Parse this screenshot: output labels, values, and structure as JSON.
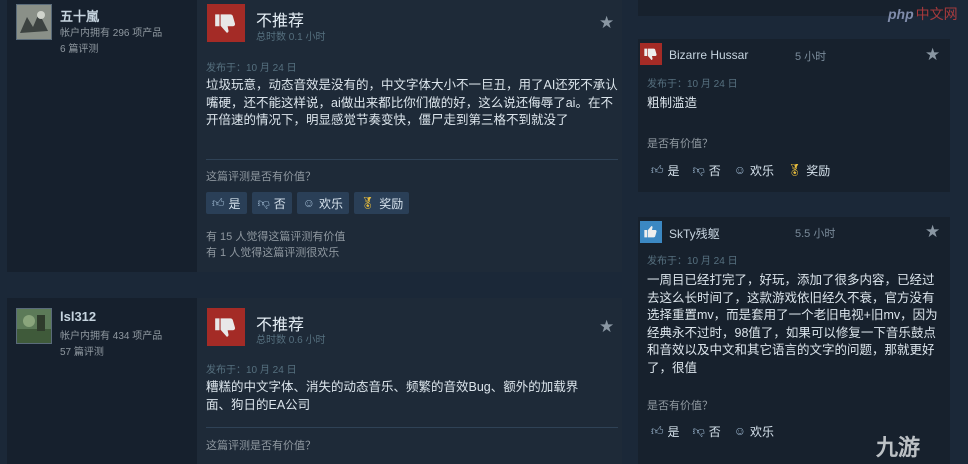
{
  "reviews_left": [
    {
      "username": "五十嵐",
      "products": "帐户内拥有 296 项产品",
      "review_count": "6 篇评测",
      "verdict": "不推荐",
      "hours": "总时数 0.1 小时",
      "posted": "发布于：10 月 24 日",
      "text": "垃圾玩意，动态音效是没有的，中文字体大小不一巨丑，用了AI还死不承认嘴硬，还不能这样说，ai做出来都比你们做的好，这么说还侮辱了ai。在不开倍速的情况下，明显感觉节奏变快，僵尸走到第三格不到就没了",
      "question": "这篇评测是否有价值？",
      "buttons": {
        "yes": "是",
        "no": "否",
        "funny": "欢乐",
        "award": "奖励"
      },
      "helpful": "有 15 人觉得这篇评测有价值",
      "funny_count": "有 1 人觉得这篇评测很欢乐"
    },
    {
      "username": "lsl312",
      "products": "帐户内拥有 434 项产品",
      "review_count": "57 篇评测",
      "verdict": "不推荐",
      "hours": "总时数 0.6 小时",
      "posted": "发布于：10 月 24 日",
      "text": "糟糕的中文字体、消失的动态音乐、频繁的音效Bug、额外的加载界面、狗日的EA公司",
      "question": "这篇评测是否有价值？"
    }
  ],
  "reviews_right": [
    {
      "username": "Bizarre Hussar",
      "hours": "5 小时",
      "posted": "发布于：10 月 24 日",
      "text": "粗制滥造",
      "question": "是否有价值？",
      "buttons": {
        "yes": "是",
        "no": "否",
        "funny": "欢乐",
        "award": "奖励"
      },
      "recommended": false
    },
    {
      "username": "SkTy残躯",
      "hours": "5.5 小时",
      "posted": "发布于：10 月 24 日",
      "text": "一周目已经打完了，好玩，添加了很多内容，已经过去这么长时间了，这款游戏依旧经久不衰，官方没有选择重置mv，而是套用了一个老旧电视+旧mv，因为经典永不过时，98值了，如果可以修复一下音乐鼓点和音效以及中文和其它语言的文字的问题，那就更好了，很值",
      "question": "是否有价值？",
      "buttons": {
        "yes": "是",
        "no": "否",
        "funny": "欢乐"
      },
      "recommended": true
    }
  ],
  "watermarks": {
    "php": "php",
    "site": "中文网",
    "brand": "九游"
  },
  "icons": {
    "thumb_down": "thumb-down-icon",
    "thumb_up": "thumb-up-icon",
    "star": "star-icon",
    "smile": "smile-icon",
    "award": "award-icon"
  },
  "colors": {
    "thumb_down_bg": "#a42b26",
    "thumb_up_bg": "#3b88c3",
    "background": "#1b2838"
  }
}
